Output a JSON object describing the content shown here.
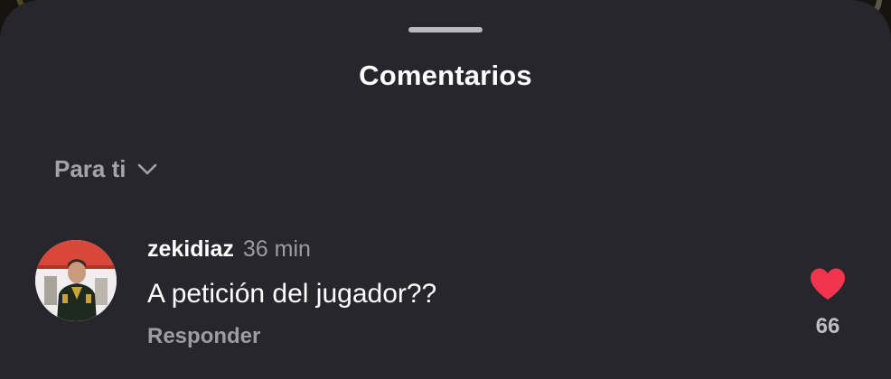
{
  "sheet": {
    "title": "Comentarios"
  },
  "filter": {
    "label": "Para ti",
    "icon": "chevron-down-icon"
  },
  "comment": {
    "username": "zekidiaz",
    "time": "36 min",
    "text": "A petición del jugador??",
    "reply_label": "Responder",
    "like_count": "66",
    "like_icon": "heart-icon",
    "liked": true
  },
  "colors": {
    "sheet_background": "#26262c",
    "like": "#f2344d",
    "secondary_text": "#9c9ca3"
  }
}
